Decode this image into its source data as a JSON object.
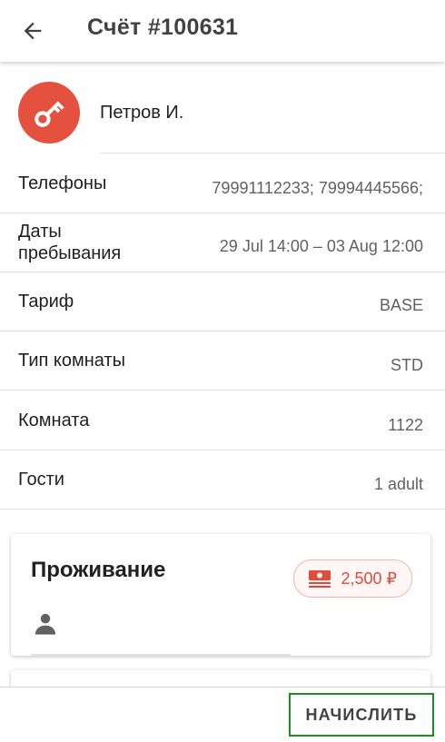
{
  "header": {
    "title": "Счёт #100631",
    "back_icon": "arrow-left-icon"
  },
  "guest": {
    "name": "Петров И.",
    "avatar_icon": "key-icon",
    "avatar_color": "#e4523f"
  },
  "details": {
    "phones": {
      "label": "Телефоны",
      "value": "79991112233; 79994445566;"
    },
    "stay_dates": {
      "label": "Даты пребывания",
      "value": "29 Jul 14:00 – 03 Aug 12:00"
    },
    "tariff": {
      "label": "Тариф",
      "value": "BASE"
    },
    "room_type": {
      "label": "Тип комнаты",
      "value": "STD"
    },
    "room": {
      "label": "Комната",
      "value": "1122"
    },
    "guests": {
      "label": "Гости",
      "value": "1 adult"
    }
  },
  "card": {
    "title": "Проживание",
    "price": "2,500 ₽",
    "price_icon": "money-stack-icon",
    "person_icon": "person-icon",
    "accent_color": "#e04b3a"
  },
  "footer": {
    "charge_label": "НАЧИСЛИТЬ",
    "highlight_color": "#1e8e1e"
  }
}
